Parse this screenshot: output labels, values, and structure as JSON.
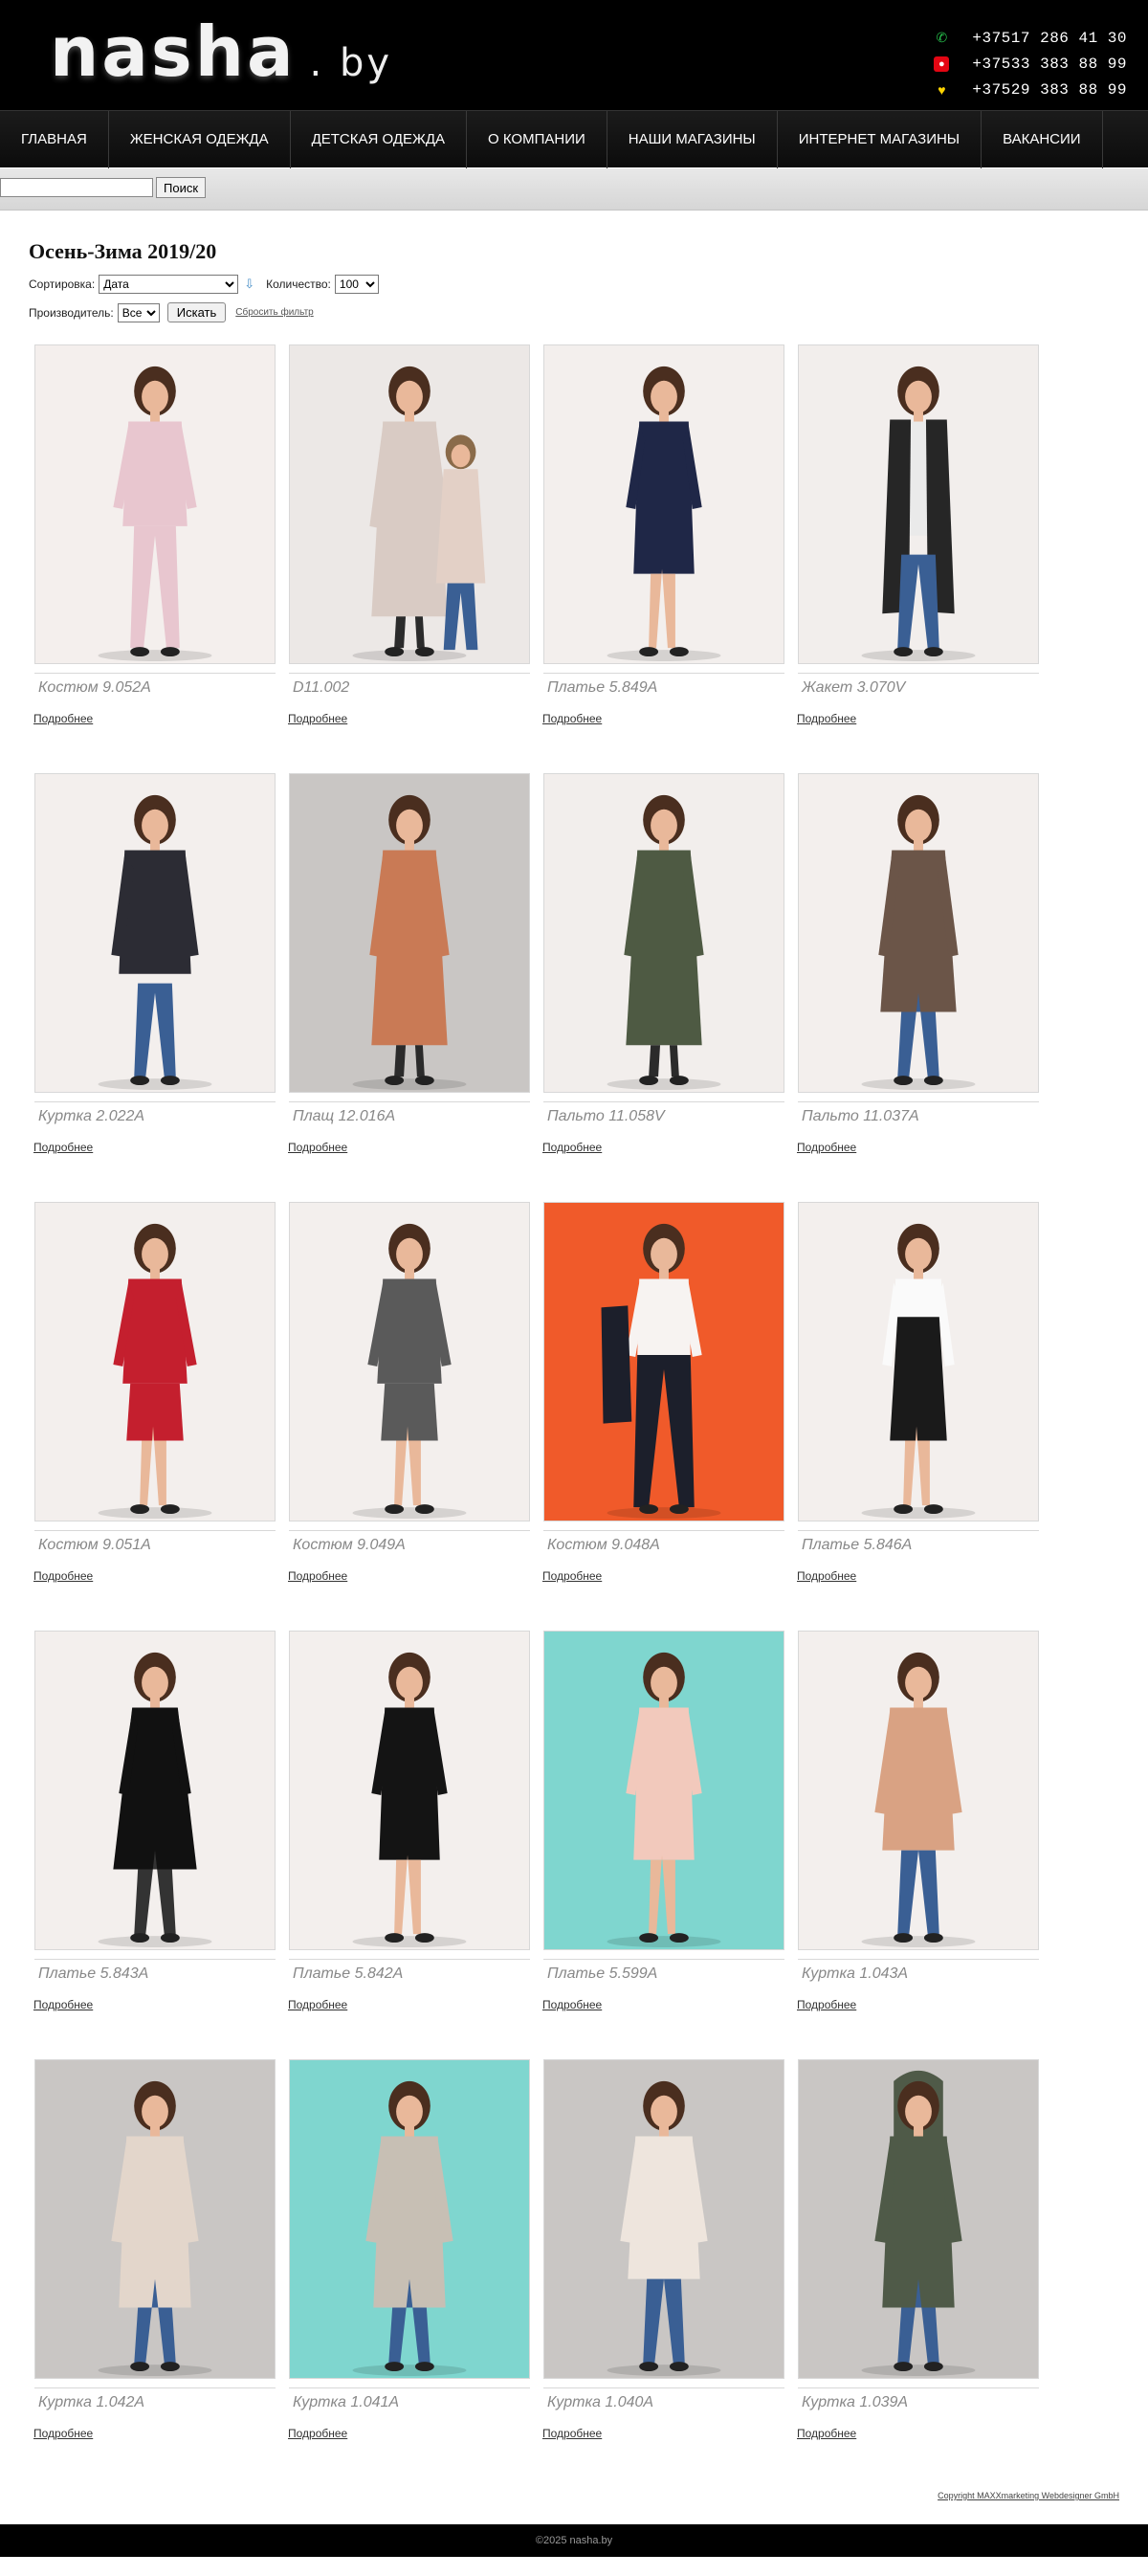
{
  "header": {
    "logo_main": "nasha",
    "logo_suffix": ". by",
    "phones": [
      {
        "number": "+37517 286 41 30",
        "icon": "landline-phone-icon"
      },
      {
        "number": "+37533 383 88 99",
        "icon": "mts-operator-icon"
      },
      {
        "number": "+37529 383 88 99",
        "icon": "velcom-operator-icon"
      }
    ]
  },
  "nav": {
    "items": [
      "ГЛАВНАЯ",
      "ЖЕНСКАЯ ОДЕЖДА",
      "ДЕТСКАЯ ОДЕЖДА",
      "О КОМПАНИИ",
      "НАШИ МАГАЗИНЫ",
      "ИНТЕРНЕТ МАГАЗИНЫ",
      "ВАКАНСИИ"
    ]
  },
  "search": {
    "value": "",
    "button_label": "Поиск"
  },
  "catalog": {
    "title": "Осень-Зима 2019/20",
    "sort_label": "Сортировка:",
    "sort_value": "Дата",
    "count_label": "Количество:",
    "count_value": "100",
    "maker_label": "Производитель:",
    "maker_value": "Все",
    "find_button": "Искать",
    "reset_link": "Сбросить фильтр",
    "more_label": "Подробнее",
    "products": [
      {
        "name": "Костюм 9.052A",
        "bg": "#f4efed",
        "garment": "#e8c6cf",
        "style": "suit"
      },
      {
        "name": "D11.002",
        "bg": "#ece8e6",
        "garment": "#d9cbc4",
        "style": "coat-duo"
      },
      {
        "name": "Платье 5.849A",
        "bg": "#f3efed",
        "garment": "#1f2747",
        "style": "dress"
      },
      {
        "name": "Жакет 3.070V",
        "bg": "#f2eeec",
        "garment": "#262626",
        "style": "long-vest"
      },
      {
        "name": "Куртка 2.022A",
        "bg": "#f3efed",
        "garment": "#2c2c34",
        "style": "jacket"
      },
      {
        "name": "Плащ 12.016A",
        "bg": "#c9c6c4",
        "garment": "#c97a55",
        "style": "long-coat"
      },
      {
        "name": "Пальто 11.058V",
        "bg": "#f2eeec",
        "garment": "#4e5a43",
        "style": "long-coat"
      },
      {
        "name": "Пальто 11.037A",
        "bg": "#f3efed",
        "garment": "#6b5548",
        "style": "coat"
      },
      {
        "name": "Костюм 9.051A",
        "bg": "#f3efed",
        "garment": "#c41f2e",
        "style": "suit-skirt"
      },
      {
        "name": "Костюм 9.049A",
        "bg": "#f3efed",
        "garment": "#5a5a5a",
        "style": "suit-skirt"
      },
      {
        "name": "Костюм 9.048A",
        "bg": "#f05a2a",
        "garment": "#1c1f2b",
        "style": "blouse-pants"
      },
      {
        "name": "Платье 5.846A",
        "bg": "#f3efed",
        "garment": "#1a1a1a",
        "style": "pinafore"
      },
      {
        "name": "Платье 5.843A",
        "bg": "#f3efed",
        "garment": "#111111",
        "style": "dress-flare"
      },
      {
        "name": "Платье 5.842A",
        "bg": "#f3efed",
        "garment": "#141414",
        "style": "dress"
      },
      {
        "name": "Платье 5.599A",
        "bg": "#7fd6cf",
        "garment": "#f2c9bc",
        "style": "dress"
      },
      {
        "name": "Куртка 1.043A",
        "bg": "#f3efed",
        "garment": "#d9a283",
        "style": "parka"
      },
      {
        "name": "Куртка 1.042A",
        "bg": "#c9c6c4",
        "garment": "#e3d6cb",
        "style": "parka-long"
      },
      {
        "name": "Куртка 1.041A",
        "bg": "#7fd6cf",
        "garment": "#c7bfb4",
        "style": "parka-long"
      },
      {
        "name": "Куртка 1.040A",
        "bg": "#c9c6c4",
        "garment": "#eee5dd",
        "style": "parka"
      },
      {
        "name": "Куртка 1.039A",
        "bg": "#c9c6c4",
        "garment": "#4f5a48",
        "style": "parka-hood"
      }
    ]
  },
  "footer": {
    "credit": "Copyright MAXXmarketing Webdesigner GmbH",
    "copyright": "©2025 nasha.by"
  }
}
